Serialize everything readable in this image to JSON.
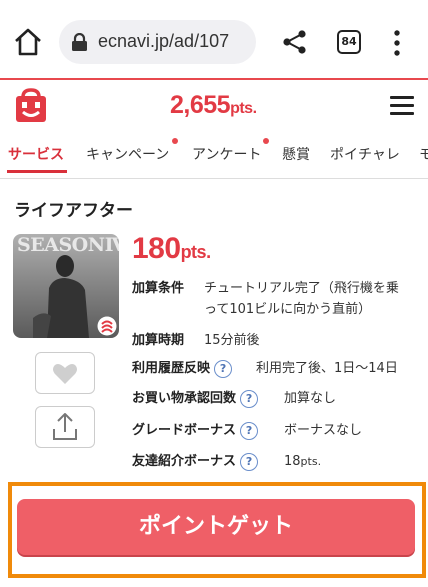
{
  "browser": {
    "url": "ecnavi.jp/ad/107",
    "tab_count": "84",
    "icons": [
      "home-icon",
      "lock-icon",
      "share-icon",
      "tabs-icon",
      "more-icon"
    ]
  },
  "header": {
    "points": "2,655",
    "points_unit": "pts.",
    "accent_color": "#e23a44"
  },
  "nav": {
    "items": [
      {
        "label": "サービス",
        "active": true
      },
      {
        "label": "キャンペーン",
        "dot": true
      },
      {
        "label": "アンケート",
        "dot": true
      },
      {
        "label": "懸賞"
      },
      {
        "label": "ポイチャレ"
      },
      {
        "label": "モ"
      }
    ]
  },
  "offer": {
    "title": "ライフアフター",
    "thumb_text": "SEASONⅣ",
    "reward": "180",
    "reward_unit": "pts.",
    "details": [
      {
        "label": "加算条件",
        "value": "チュートリアル完了（飛行機を乗",
        "value2": "って101ビルに向かう直前）"
      },
      {
        "label": "加算時期",
        "value": "15分前後"
      },
      {
        "label": "利用履歴反映",
        "help": "?",
        "value": "利用完了後、1日〜14日"
      },
      {
        "label": "お買い物承認回数",
        "help": "?",
        "value": "加算なし"
      },
      {
        "label": "グレードボーナス",
        "help": "?",
        "value": "ボーナスなし"
      },
      {
        "label": "友達紹介ボーナス",
        "help": "?",
        "value": "18",
        "value_unit": "pts."
      }
    ]
  },
  "cta": {
    "label": "ポイントゲット",
    "frame_color": "#f08a0a",
    "button_color": "#ef5f67"
  }
}
